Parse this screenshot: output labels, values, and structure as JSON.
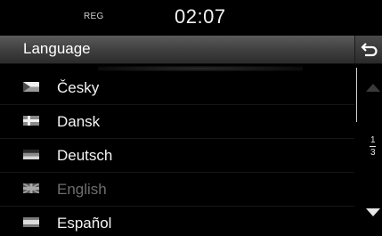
{
  "status": {
    "reg": "REG",
    "time": "02:07"
  },
  "header": {
    "title": "Language",
    "back_icon": "back-arrow-icon"
  },
  "languages": [
    {
      "label": "Česky",
      "icon": "czech-flag-icon",
      "dim": false
    },
    {
      "label": "Dansk",
      "icon": "danish-flag-icon",
      "dim": false
    },
    {
      "label": "Deutsch",
      "icon": "german-flag-icon",
      "dim": false
    },
    {
      "label": "English",
      "icon": "uk-flag-icon",
      "dim": true
    },
    {
      "label": "Español",
      "icon": "spanish-flag-icon",
      "dim": false
    }
  ],
  "pagination": {
    "current": "1",
    "total": "3"
  },
  "colors": {
    "background": "#000000",
    "text": "#f4f4f4",
    "dim_text": "#6e6e6e"
  }
}
